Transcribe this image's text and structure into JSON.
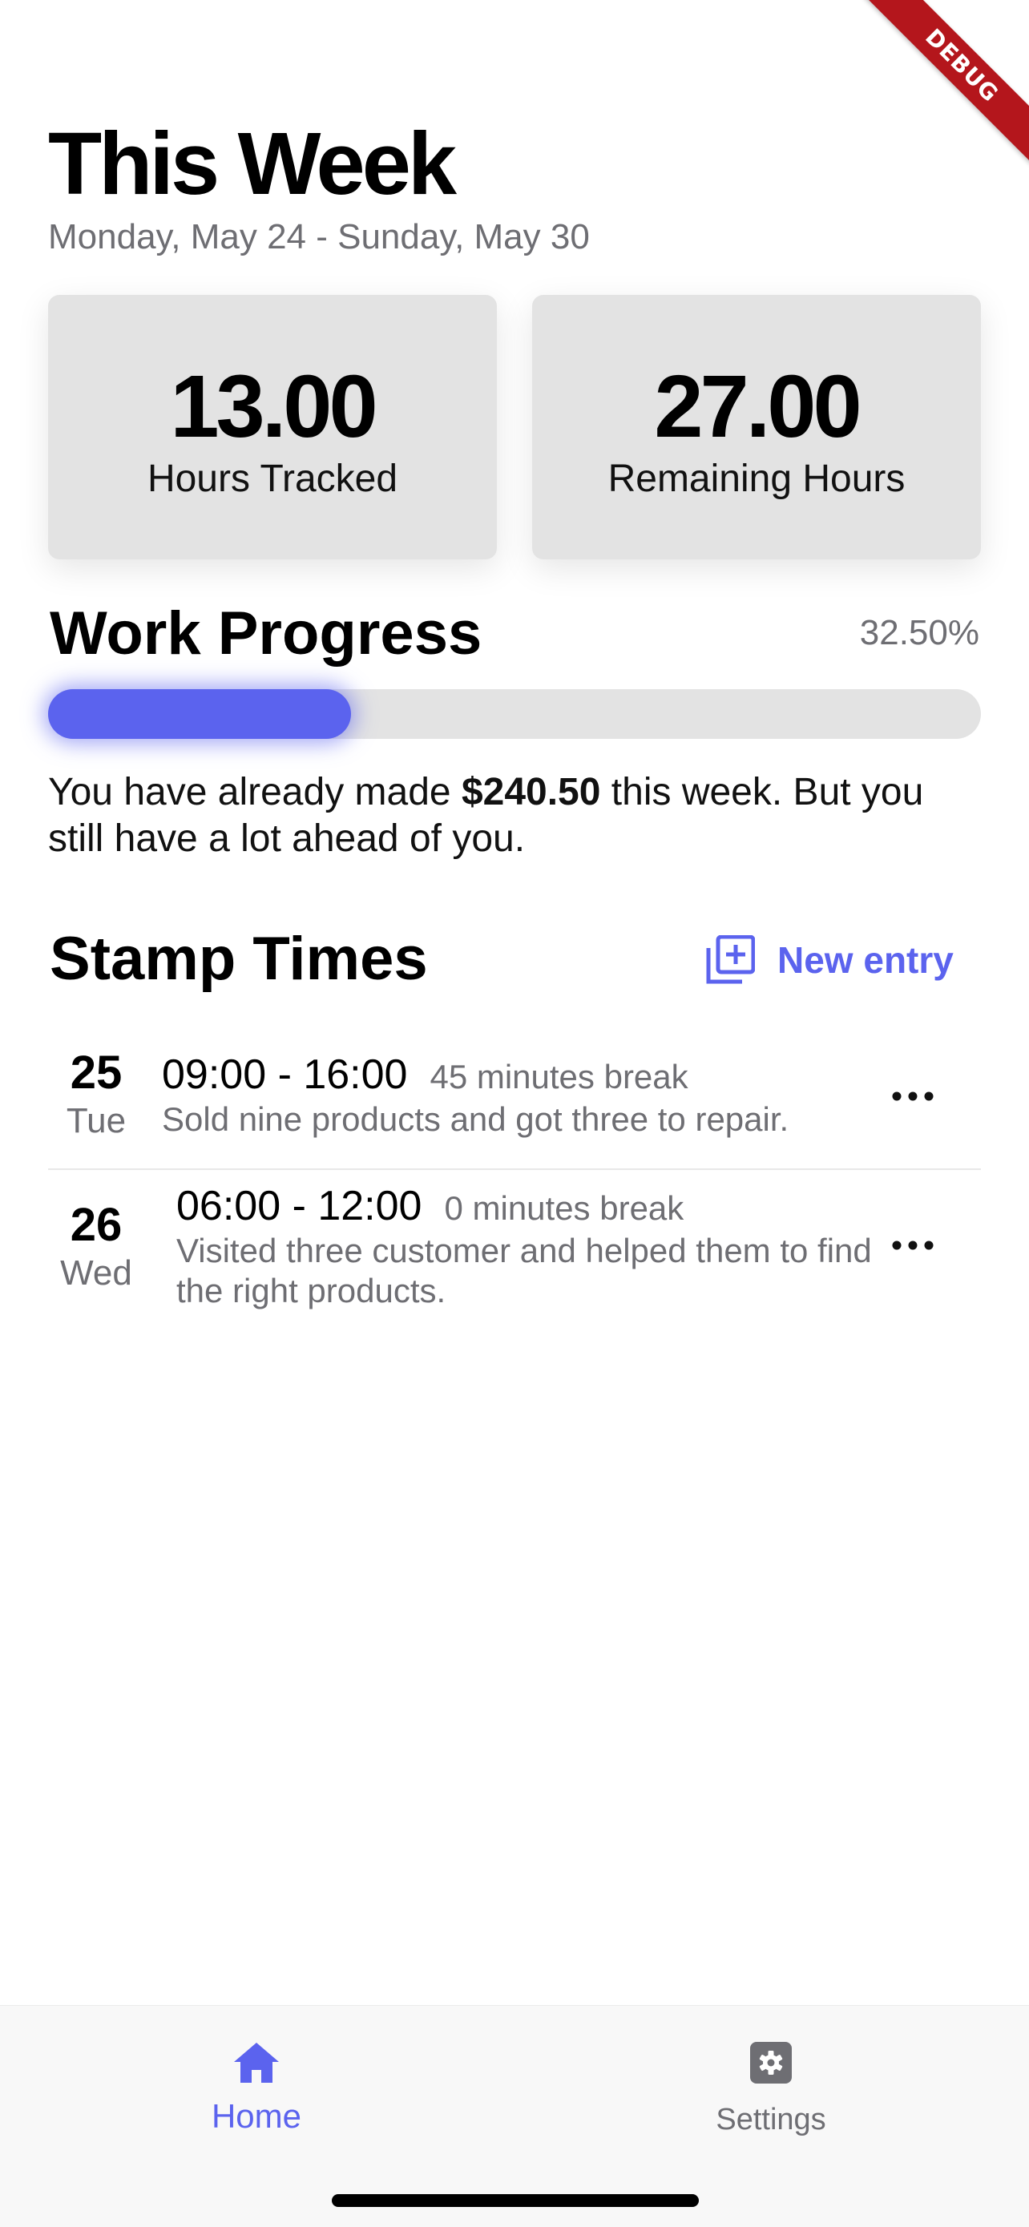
{
  "debug_banner": "DEBUG",
  "header": {
    "title": "This Week",
    "range": "Monday, May 24 - Sunday, May 30"
  },
  "stats": {
    "tracked": {
      "value": "13.00",
      "label": "Hours Tracked"
    },
    "remaining": {
      "value": "27.00",
      "label": "Remaining Hours"
    }
  },
  "progress": {
    "heading": "Work Progress",
    "percent_label": "32.50%",
    "fraction": 0.325,
    "earnings_prefix": "You have already made ",
    "earnings_amount": "$240.50",
    "earnings_suffix": " this week. But you still have a lot ahead of you."
  },
  "stamps": {
    "heading": "Stamp Times",
    "new_entry_label": "New entry",
    "new_entry_icon": "add-box-icon",
    "more_icon": "more-horizontal-icon",
    "entries": [
      {
        "day": "25",
        "weekday": "Tue",
        "time": "09:00 - 16:00",
        "break": "45 minutes break",
        "description": "Sold nine products and got three to repair."
      },
      {
        "day": "26",
        "weekday": "Wed",
        "time": "06:00 - 12:00",
        "break": "0 minutes break",
        "description": "Visited three customer and helped them to find the right products."
      }
    ]
  },
  "nav": {
    "home": {
      "label": "Home",
      "icon": "home-icon"
    },
    "settings": {
      "label": "Settings",
      "icon": "gear-icon"
    }
  },
  "colors": {
    "accent": "#5b63ee",
    "card_bg": "#e3e3e3",
    "secondary_text": "#6e6e73",
    "debug_ribbon": "#b4161c"
  }
}
